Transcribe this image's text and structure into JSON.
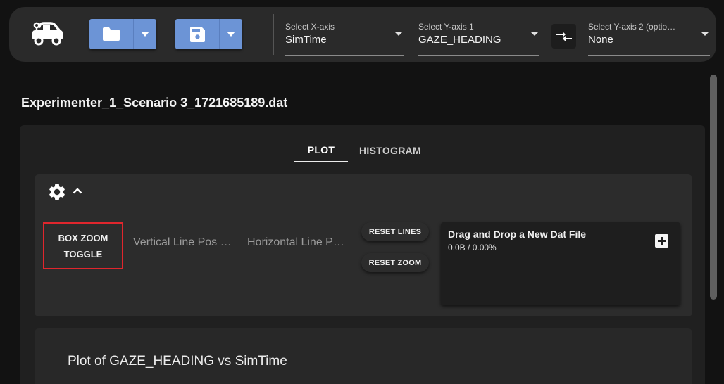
{
  "toolbar": {
    "x_axis": {
      "label": "Select X-axis",
      "value": "SimTime"
    },
    "y_axis_1": {
      "label": "Select Y-axis 1",
      "value": "GAZE_HEADING"
    },
    "y_axis_2": {
      "label": "Select Y-axis 2 (optio…",
      "value": "None"
    },
    "icons": {
      "logo": "car-logo-icon",
      "open": "folder-icon",
      "save": "floppy-disk-icon",
      "swap": "swap-arrows-icon"
    },
    "button_color": "#6c94d6"
  },
  "file_title": "Experimenter_1_Scenario 3_1721685189.dat",
  "tabs": [
    {
      "label": "PLOT",
      "active": true
    },
    {
      "label": "HISTOGRAM",
      "active": false
    }
  ],
  "controls": {
    "box_zoom_line1": "BOX ZOOM",
    "box_zoom_line2": "TOGGLE",
    "vertical_line_placeholder": "Vertical Line Pos …",
    "horizontal_line_placeholder": "Horizontal Line P…",
    "reset_lines": "RESET LINES",
    "reset_zoom": "RESET ZOOM",
    "highlight_color": "#e0262d"
  },
  "dropzone": {
    "title": "Drag and Drop a New Dat File",
    "progress": "0.0B / 0.00%"
  },
  "plot": {
    "title": "Plot of GAZE_HEADING vs SimTime"
  }
}
